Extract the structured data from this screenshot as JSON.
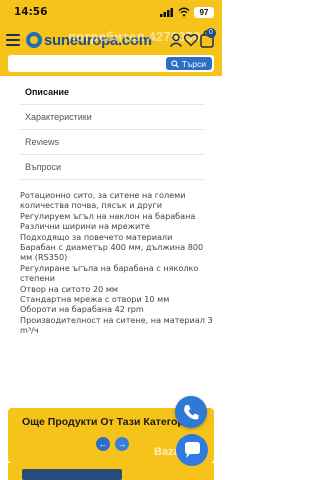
{
  "status_bar": {
    "time": "14:56",
    "battery": "97"
  },
  "header": {
    "logo_text": "suneuropa.com",
    "watermark": "потребител 4279350",
    "cart_count": "0",
    "search": {
      "placeholder": "",
      "button_label": "Търси"
    }
  },
  "tabs": [
    {
      "label": "Описание",
      "active": true
    },
    {
      "label": "Характеристики",
      "active": false
    },
    {
      "label": "Reviews",
      "active": false
    },
    {
      "label": "Въпроси",
      "active": false
    }
  ],
  "description": [
    "Ротационно сито, за ситене на големи количества почва, пясък и други",
    "Регулируем ъгъл на наклон на барабана",
    "Различни ширини на мрежите",
    "Подходящо за повечето материали",
    "Барабан с диаметър 400 мм, дължина 800 мм (RS350)",
    "Регулиране ъгъла на барабана с няколко степени",
    "Отвор на ситото 20 мм",
    "Стандартна мрежа с отвори 10 мм",
    "Обороти на барабана 42 rpm",
    "Производителност на ситене, на материал 3 m³/ч"
  ],
  "promo": {
    "title": "Още Продукти От Тази Категория",
    "prev": "←",
    "next": "→"
  },
  "bazar_watermark": "Bazar",
  "colors": {
    "brand_yellow": "#f6c31a",
    "brand_blue": "#1f4b8f",
    "button_blue": "#2e6fc6"
  },
  "icons": [
    "menu-icon",
    "user-icon",
    "heart-icon",
    "cart-icon",
    "search-icon",
    "phone-icon",
    "chat-icon"
  ]
}
